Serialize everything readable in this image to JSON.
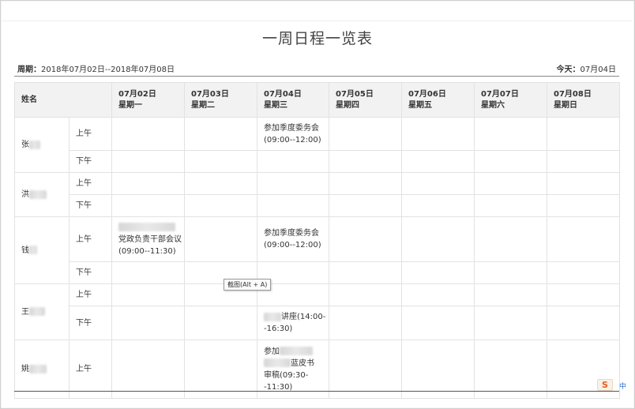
{
  "page": {
    "title": "一周日程一览表",
    "period_label": "周期：",
    "period_value": "2018年07月02日--2018年07月08日",
    "today_label": "今天：",
    "today_value": "07月04日"
  },
  "table": {
    "name_header": "姓名",
    "days": [
      {
        "date": "07月02日",
        "weekday": "星期一"
      },
      {
        "date": "07月03日",
        "weekday": "星期二"
      },
      {
        "date": "07月04日",
        "weekday": "星期三"
      },
      {
        "date": "07月05日",
        "weekday": "星期四"
      },
      {
        "date": "07月06日",
        "weekday": "星期五"
      },
      {
        "date": "07月07日",
        "weekday": "星期六"
      },
      {
        "date": "07月08日",
        "weekday": "星期日"
      }
    ],
    "am_label": "上午",
    "pm_label": "下午",
    "people": [
      {
        "name": "张",
        "am": [
          "",
          "",
          "参加季度委务会(09:00--12:00)",
          "",
          "",
          "",
          ""
        ],
        "pm": [
          "",
          "",
          "",
          "",
          "",
          "",
          ""
        ]
      },
      {
        "name": "洪",
        "am": [
          "",
          "",
          "",
          "",
          "",
          "",
          ""
        ],
        "pm": [
          "",
          "",
          "",
          "",
          "",
          "",
          ""
        ]
      },
      {
        "name": "钱",
        "am": [
          "党政负责干部会议(09:00--11:30)",
          "",
          "参加季度委务会(09:00--12:00)",
          "",
          "",
          "",
          ""
        ],
        "pm": [
          "",
          "",
          "",
          "",
          "",
          "",
          ""
        ]
      },
      {
        "name": "王",
        "am": [
          "",
          "",
          "",
          "",
          "",
          "",
          ""
        ],
        "pm": [
          "",
          "",
          "讲座(14:00--16:30)",
          "",
          "",
          "",
          ""
        ]
      },
      {
        "name": "姚",
        "am": [
          "",
          "",
          "参加",
          "",
          "",
          "",
          ""
        ],
        "pm": []
      }
    ],
    "extra_fragments": {
      "yao_line2": "蓝皮书",
      "yao_line3": "审稿(09:30-",
      "yao_line4": "-11:30)"
    }
  },
  "tooltip": "截图(Alt + A)",
  "ime": {
    "logo": "S",
    "mode": "中"
  }
}
